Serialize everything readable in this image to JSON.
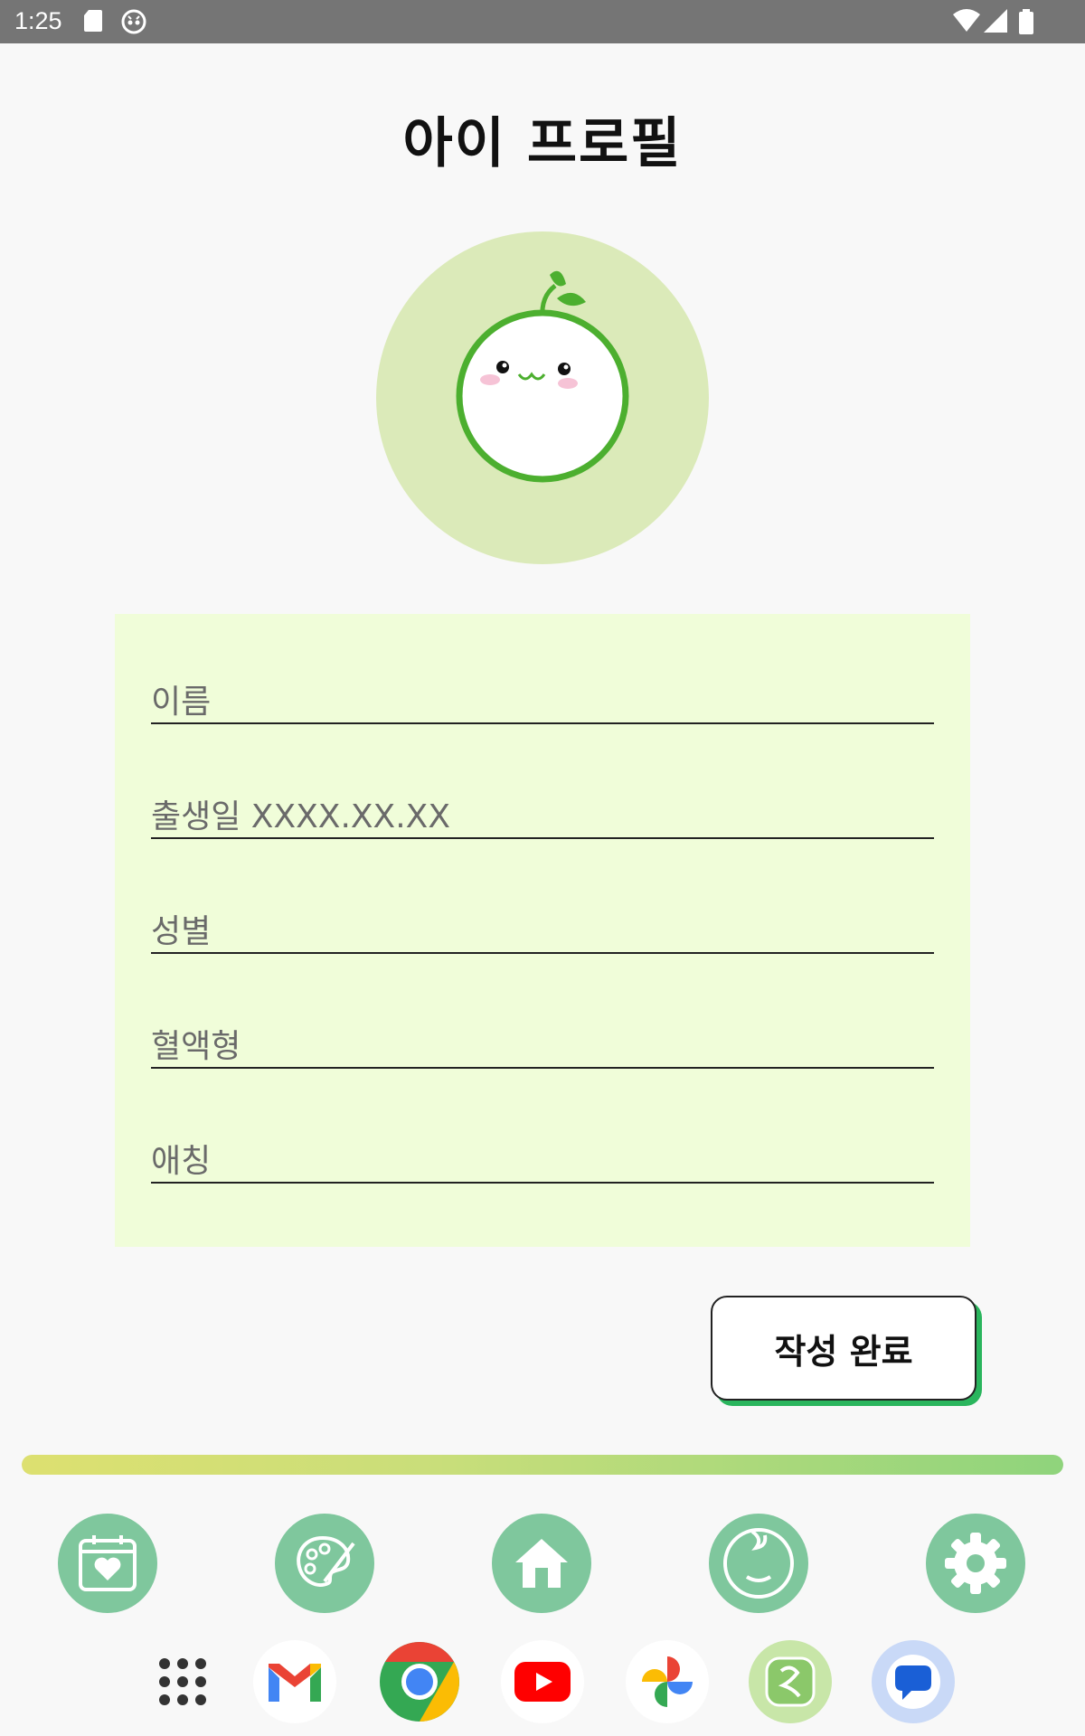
{
  "status_bar": {
    "time": "1:25",
    "icons": [
      "sd-card-icon",
      "robot-face-icon",
      "wifi-icon",
      "signal-icon",
      "battery-icon"
    ]
  },
  "page": {
    "title": "아이 프로필"
  },
  "avatar": {
    "icon": "seedling-mascot-icon",
    "face": "•ᴗ•"
  },
  "form": {
    "fields": [
      {
        "key": "name",
        "placeholder": "이름",
        "value": ""
      },
      {
        "key": "birth",
        "placeholder": "출생일 XXXX.XX.XX",
        "value": ""
      },
      {
        "key": "gender",
        "placeholder": "성별",
        "value": ""
      },
      {
        "key": "blood",
        "placeholder": "혈액형",
        "value": ""
      },
      {
        "key": "nickname",
        "placeholder": "애칭",
        "value": ""
      }
    ]
  },
  "submit_button": {
    "label": "작성 완료"
  },
  "progress": {
    "fraction": 1.0
  },
  "bottom_nav": {
    "items": [
      {
        "icon": "calendar-heart-icon"
      },
      {
        "icon": "palette-icon"
      },
      {
        "icon": "home-icon"
      },
      {
        "icon": "baby-face-icon"
      },
      {
        "icon": "gear-icon"
      }
    ]
  },
  "dock": {
    "apps": [
      "app-drawer-icon",
      "gmail-icon",
      "chrome-icon",
      "youtube-icon",
      "photos-icon",
      "app-green-icon",
      "messages-icon"
    ]
  },
  "colors": {
    "status_bar": "#757575",
    "avatar_bg": "#dbeab9",
    "card_bg": "#f0fdd9",
    "nav_button": "#7fc79d",
    "button_shadow": "#2ab55d"
  }
}
